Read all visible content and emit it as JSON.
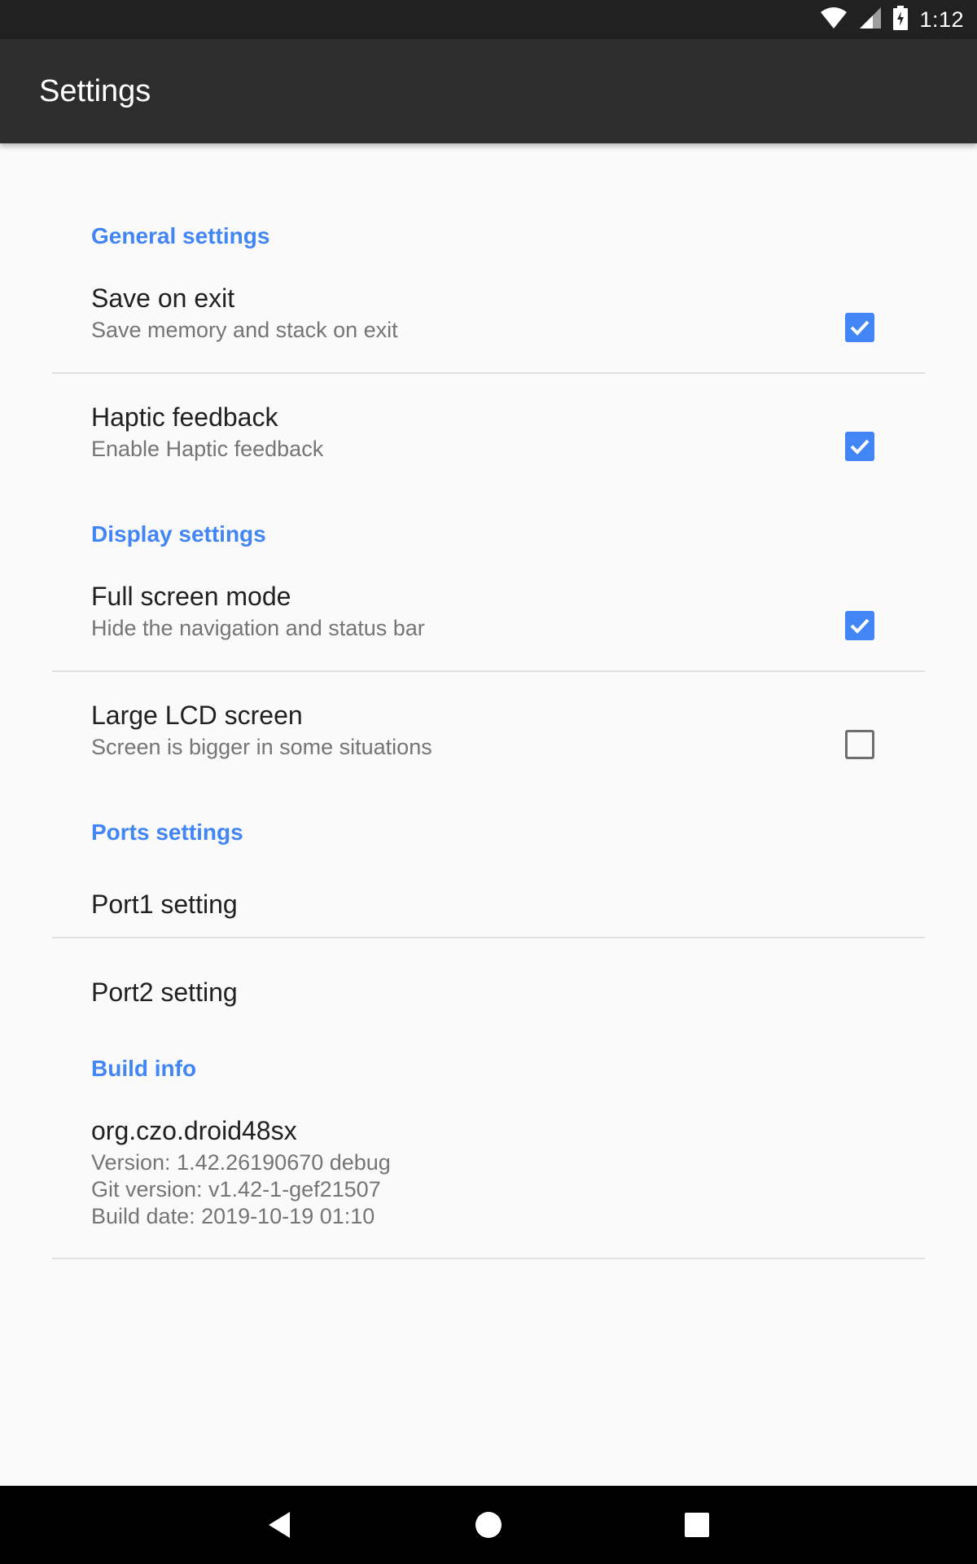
{
  "status_bar": {
    "time": "1:12",
    "icons": [
      "wifi-icon",
      "cell-signal-icon",
      "battery-charging-icon"
    ]
  },
  "app_bar": {
    "title": "Settings"
  },
  "sections": {
    "general": {
      "header": "General settings",
      "save_on_exit": {
        "title": "Save on exit",
        "summary": "Save memory and stack on exit",
        "checked": true
      },
      "haptic": {
        "title": "Haptic feedback",
        "summary": "Enable Haptic feedback",
        "checked": true
      }
    },
    "display": {
      "header": "Display settings",
      "full_screen": {
        "title": "Full screen mode",
        "summary": "Hide the navigation and status bar",
        "checked": true
      },
      "large_lcd": {
        "title": "Large LCD screen",
        "summary": "Screen is bigger in some situations",
        "checked": false
      }
    },
    "ports": {
      "header": "Ports settings",
      "port1": {
        "title": "Port1 setting"
      },
      "port2": {
        "title": "Port2 setting"
      }
    },
    "build": {
      "header": "Build info",
      "package": "org.czo.droid48sx",
      "version": "Version: 1.42.26190670 debug",
      "git_version": "Git version: v1.42-1-gef21507",
      "build_date": "Build date: 2019-10-19 01:10"
    }
  },
  "nav_bar": {
    "icons": [
      "back-icon",
      "home-icon",
      "recents-icon"
    ]
  },
  "colors": {
    "accent": "#4285f4",
    "app_bar": "#2d2d2d",
    "status_bar": "#212121",
    "background": "#fafafa"
  }
}
